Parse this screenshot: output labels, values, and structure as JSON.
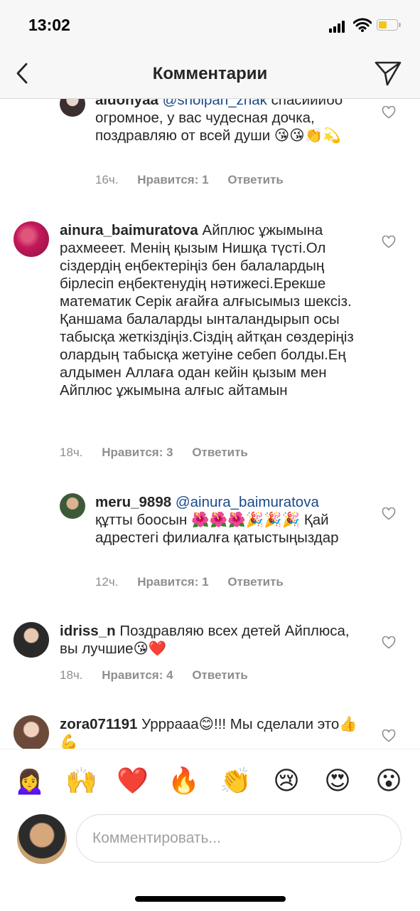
{
  "status_bar": {
    "time": "13:02"
  },
  "header": {
    "title": "Комментарии"
  },
  "comments": [
    {
      "username": "aidonyaa",
      "mention": "@sholpan_znak",
      "text": "спасииибо огромное, у вас чудесная дочка, поздравляю от всей души 😘😘👏💫",
      "time": "16ч.",
      "likes": "Нравится: 1",
      "reply": "Ответить"
    },
    {
      "username": "ainura_baimuratova",
      "text": "Айплюс ұжымына рахмееет. Менің қызым Нишқа түсті.Ол сіздердің еңбектеріңіз бен балалардың бірлесіп еңбектенудің нәтижесі.Ерекше математик Серік ағайға алғысымыз шексіз. Қаншама балаларды ынталандырып осы табысқа жеткіздіңіз.Сіздің айтқан сөздеріңіз олардың табысқа жетуіне себеп болды.Ең алдымен Аллаға одан кейін қызым мен Айплюс ұжымына алғыс айтамын",
      "time": "18ч.",
      "likes": "Нравится: 3",
      "reply": "Ответить"
    },
    {
      "username": "meru_9898",
      "mention": "@ainura_baimuratova",
      "text": "құтты боосын 🌺🌺🌺🎉🎉🎉 Қай адрестегі филиалға қатыстыңыздар",
      "time": "12ч.",
      "likes": "Нравится: 1",
      "reply": "Ответить"
    },
    {
      "username": "idriss_n",
      "text": "Поздравляю всех детей Айплюса, вы лучшие😘❤️",
      "time": "18ч.",
      "likes": "Нравится: 4",
      "reply": "Ответить"
    },
    {
      "username": "zora071191",
      "text": "Урррааа😊!!! Мы сделали это👍💪"
    }
  ],
  "emoji_bar": [
    "🙍‍♀️",
    "🙌",
    "❤️",
    "🔥",
    "👏",
    "😢",
    "😍",
    "😮"
  ],
  "input": {
    "placeholder": "Комментировать..."
  }
}
